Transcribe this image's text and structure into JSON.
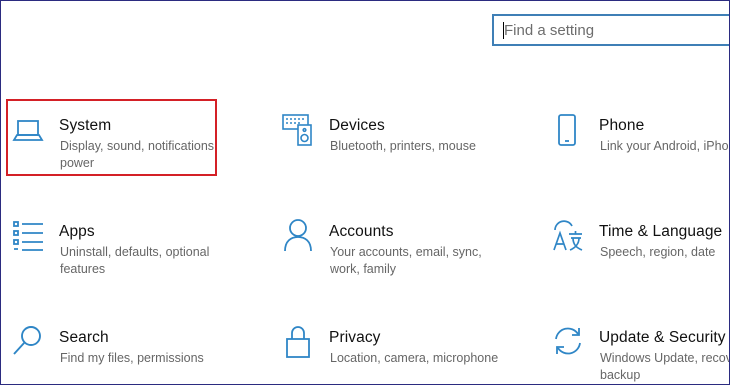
{
  "search": {
    "placeholder": "Find a setting"
  },
  "accent_color": "#2f86c6",
  "highlight_color": "#d42026",
  "categories": [
    {
      "title": "System",
      "description": "Display, sound, notifications, power",
      "icon": "laptop-icon"
    },
    {
      "title": "Devices",
      "description": "Bluetooth, printers, mouse",
      "icon": "keyboard-speaker-icon"
    },
    {
      "title": "Phone",
      "description": "Link your Android, iPhone",
      "icon": "phone-icon"
    },
    {
      "title": "Apps",
      "description": "Uninstall, defaults, optional features",
      "icon": "apps-list-icon"
    },
    {
      "title": "Accounts",
      "description": "Your accounts, email, sync, work, family",
      "icon": "person-icon"
    },
    {
      "title": "Time & Language",
      "description": "Speech, region, date",
      "icon": "time-language-icon"
    },
    {
      "title": "Search",
      "description": "Find my files, permissions",
      "icon": "search-icon"
    },
    {
      "title": "Privacy",
      "description": "Location, camera, microphone",
      "icon": "lock-icon"
    },
    {
      "title": "Update & Security",
      "description": "Windows Update, recovery, backup",
      "icon": "sync-icon"
    }
  ],
  "highlighted_item": "System"
}
